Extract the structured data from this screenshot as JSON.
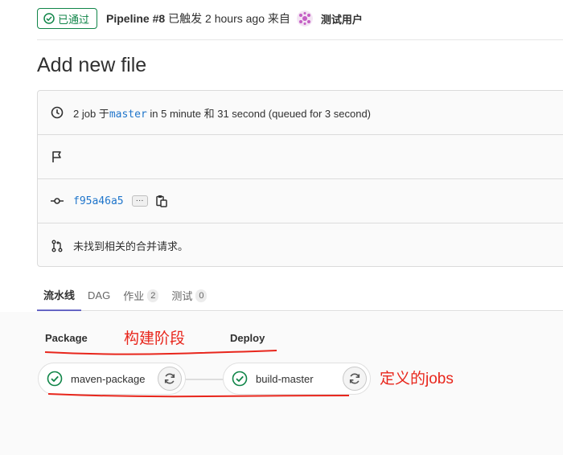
{
  "header": {
    "status_label": "已通过",
    "pipeline_label": "Pipeline #8",
    "triggered_text": "已触发 2 hours ago 来自",
    "user_name": "测试用户"
  },
  "page_title": "Add new file",
  "info": {
    "jobs_prefix": "2 job 于",
    "branch": "master",
    "jobs_suffix": " in 5 minute 和 31 second (queued for 3 second)",
    "commit_sha": "f95a46a5",
    "ellipsis": "···",
    "merge_request_text": "未找到相关的合并请求。"
  },
  "tabs": [
    {
      "label": "流水线"
    },
    {
      "label": "DAG"
    },
    {
      "label": "作业",
      "count": "2"
    },
    {
      "label": "测试",
      "count": "0"
    }
  ],
  "stages": [
    {
      "title": "Package",
      "job": "maven-package"
    },
    {
      "title": "Deploy",
      "job": "build-master"
    }
  ],
  "annotations": {
    "stage_note": "构建阶段",
    "jobs_note": "定义的jobs"
  },
  "colors": {
    "success": "#108548",
    "link": "#1f75cb",
    "annotation_red": "#e8261c",
    "tab_active": "#6666c4"
  },
  "icons": [
    "check-circle-icon",
    "clock-icon",
    "flag-icon",
    "commit-icon",
    "copy-icon",
    "merge-request-icon",
    "retry-icon"
  ]
}
